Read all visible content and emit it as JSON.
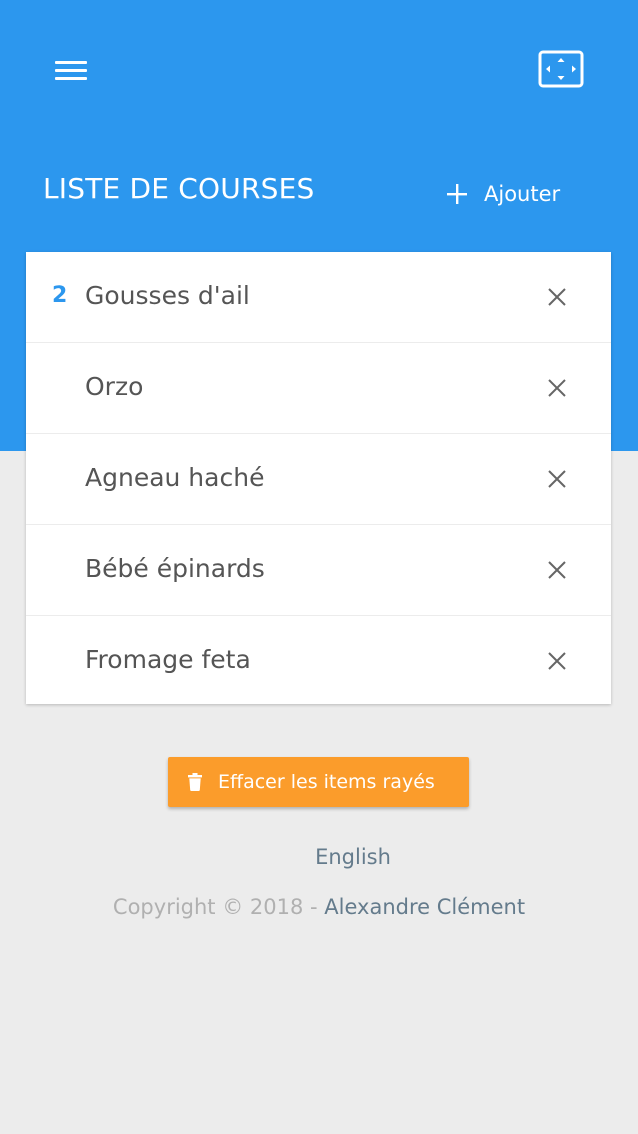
{
  "header": {
    "menu_icon": "hamburger-menu-icon",
    "fullscreen_icon": "fullscreen-icon",
    "color": "#2c97ee"
  },
  "list": {
    "title": "LISTE DE COURSES",
    "add_label": "Ajouter",
    "items": [
      {
        "qty": "2",
        "name": "Gousses d'ail"
      },
      {
        "qty": "",
        "name": "Orzo"
      },
      {
        "qty": "",
        "name": "Agneau haché"
      },
      {
        "qty": "",
        "name": "Bébé épinards"
      },
      {
        "qty": "",
        "name": "Fromage feta"
      }
    ]
  },
  "actions": {
    "clear_label": "Effacer les items rayés",
    "clear_color": "#fb9c2b"
  },
  "footer": {
    "language": "English",
    "copyright": "Copyright © 2018 -",
    "author": "Alexandre Clément"
  }
}
